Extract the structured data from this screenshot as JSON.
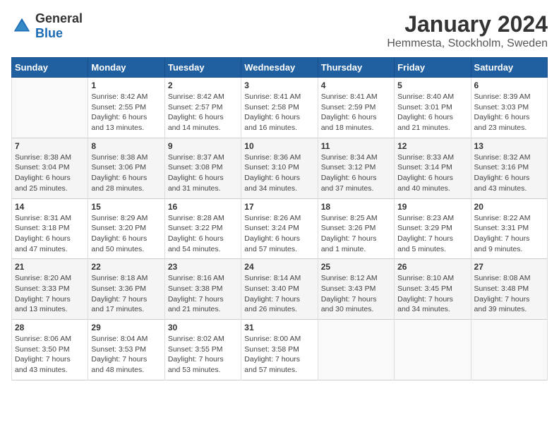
{
  "header": {
    "logo_general": "General",
    "logo_blue": "Blue",
    "main_title": "January 2024",
    "subtitle": "Hemmesta, Stockholm, Sweden"
  },
  "days_of_week": [
    "Sunday",
    "Monday",
    "Tuesday",
    "Wednesday",
    "Thursday",
    "Friday",
    "Saturday"
  ],
  "weeks": [
    [
      {
        "day": "",
        "info": ""
      },
      {
        "day": "1",
        "info": "Sunrise: 8:42 AM\nSunset: 2:55 PM\nDaylight: 6 hours\nand 13 minutes."
      },
      {
        "day": "2",
        "info": "Sunrise: 8:42 AM\nSunset: 2:57 PM\nDaylight: 6 hours\nand 14 minutes."
      },
      {
        "day": "3",
        "info": "Sunrise: 8:41 AM\nSunset: 2:58 PM\nDaylight: 6 hours\nand 16 minutes."
      },
      {
        "day": "4",
        "info": "Sunrise: 8:41 AM\nSunset: 2:59 PM\nDaylight: 6 hours\nand 18 minutes."
      },
      {
        "day": "5",
        "info": "Sunrise: 8:40 AM\nSunset: 3:01 PM\nDaylight: 6 hours\nand 21 minutes."
      },
      {
        "day": "6",
        "info": "Sunrise: 8:39 AM\nSunset: 3:03 PM\nDaylight: 6 hours\nand 23 minutes."
      }
    ],
    [
      {
        "day": "7",
        "info": "Sunrise: 8:38 AM\nSunset: 3:04 PM\nDaylight: 6 hours\nand 25 minutes."
      },
      {
        "day": "8",
        "info": "Sunrise: 8:38 AM\nSunset: 3:06 PM\nDaylight: 6 hours\nand 28 minutes."
      },
      {
        "day": "9",
        "info": "Sunrise: 8:37 AM\nSunset: 3:08 PM\nDaylight: 6 hours\nand 31 minutes."
      },
      {
        "day": "10",
        "info": "Sunrise: 8:36 AM\nSunset: 3:10 PM\nDaylight: 6 hours\nand 34 minutes."
      },
      {
        "day": "11",
        "info": "Sunrise: 8:34 AM\nSunset: 3:12 PM\nDaylight: 6 hours\nand 37 minutes."
      },
      {
        "day": "12",
        "info": "Sunrise: 8:33 AM\nSunset: 3:14 PM\nDaylight: 6 hours\nand 40 minutes."
      },
      {
        "day": "13",
        "info": "Sunrise: 8:32 AM\nSunset: 3:16 PM\nDaylight: 6 hours\nand 43 minutes."
      }
    ],
    [
      {
        "day": "14",
        "info": "Sunrise: 8:31 AM\nSunset: 3:18 PM\nDaylight: 6 hours\nand 47 minutes."
      },
      {
        "day": "15",
        "info": "Sunrise: 8:29 AM\nSunset: 3:20 PM\nDaylight: 6 hours\nand 50 minutes."
      },
      {
        "day": "16",
        "info": "Sunrise: 8:28 AM\nSunset: 3:22 PM\nDaylight: 6 hours\nand 54 minutes."
      },
      {
        "day": "17",
        "info": "Sunrise: 8:26 AM\nSunset: 3:24 PM\nDaylight: 6 hours\nand 57 minutes."
      },
      {
        "day": "18",
        "info": "Sunrise: 8:25 AM\nSunset: 3:26 PM\nDaylight: 7 hours\nand 1 minute."
      },
      {
        "day": "19",
        "info": "Sunrise: 8:23 AM\nSunset: 3:29 PM\nDaylight: 7 hours\nand 5 minutes."
      },
      {
        "day": "20",
        "info": "Sunrise: 8:22 AM\nSunset: 3:31 PM\nDaylight: 7 hours\nand 9 minutes."
      }
    ],
    [
      {
        "day": "21",
        "info": "Sunrise: 8:20 AM\nSunset: 3:33 PM\nDaylight: 7 hours\nand 13 minutes."
      },
      {
        "day": "22",
        "info": "Sunrise: 8:18 AM\nSunset: 3:36 PM\nDaylight: 7 hours\nand 17 minutes."
      },
      {
        "day": "23",
        "info": "Sunrise: 8:16 AM\nSunset: 3:38 PM\nDaylight: 7 hours\nand 21 minutes."
      },
      {
        "day": "24",
        "info": "Sunrise: 8:14 AM\nSunset: 3:40 PM\nDaylight: 7 hours\nand 26 minutes."
      },
      {
        "day": "25",
        "info": "Sunrise: 8:12 AM\nSunset: 3:43 PM\nDaylight: 7 hours\nand 30 minutes."
      },
      {
        "day": "26",
        "info": "Sunrise: 8:10 AM\nSunset: 3:45 PM\nDaylight: 7 hours\nand 34 minutes."
      },
      {
        "day": "27",
        "info": "Sunrise: 8:08 AM\nSunset: 3:48 PM\nDaylight: 7 hours\nand 39 minutes."
      }
    ],
    [
      {
        "day": "28",
        "info": "Sunrise: 8:06 AM\nSunset: 3:50 PM\nDaylight: 7 hours\nand 43 minutes."
      },
      {
        "day": "29",
        "info": "Sunrise: 8:04 AM\nSunset: 3:53 PM\nDaylight: 7 hours\nand 48 minutes."
      },
      {
        "day": "30",
        "info": "Sunrise: 8:02 AM\nSunset: 3:55 PM\nDaylight: 7 hours\nand 53 minutes."
      },
      {
        "day": "31",
        "info": "Sunrise: 8:00 AM\nSunset: 3:58 PM\nDaylight: 7 hours\nand 57 minutes."
      },
      {
        "day": "",
        "info": ""
      },
      {
        "day": "",
        "info": ""
      },
      {
        "day": "",
        "info": ""
      }
    ]
  ]
}
